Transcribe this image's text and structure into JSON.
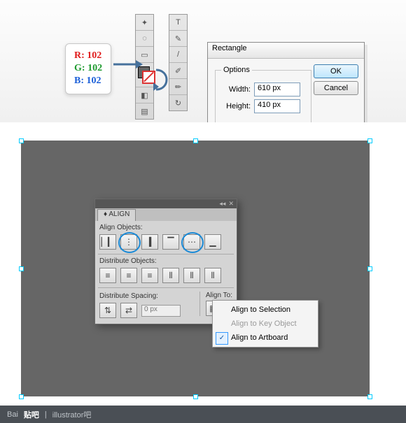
{
  "rgb": {
    "r_label": "R:",
    "r_val": "102",
    "g_label": "G:",
    "g_val": "102",
    "b_label": "B:",
    "b_val": "102"
  },
  "rect_dialog": {
    "title": "Rectangle",
    "options_legend": "Options",
    "width_label": "Width:",
    "width_value": "610 px",
    "height_label": "Height:",
    "height_value": "410 px",
    "ok": "OK",
    "cancel": "Cancel"
  },
  "align_panel": {
    "tab": "ALIGN",
    "align_objects_label": "Align Objects:",
    "distribute_objects_label": "Distribute Objects:",
    "distribute_spacing_label": "Distribute Spacing:",
    "align_to_label": "Align To:",
    "spacing_value": "0 px"
  },
  "align_menu": {
    "selection": "Align to Selection",
    "key_object": "Align to Key Object",
    "artboard": "Align to Artboard"
  },
  "footer": {
    "brand1": "Bai",
    "brand2": "贴吧",
    "sep": "|",
    "board": "illustrator吧"
  },
  "colors": {
    "rect_fill": "#666666",
    "highlight": "#1b8ad6"
  },
  "chart_data": null
}
